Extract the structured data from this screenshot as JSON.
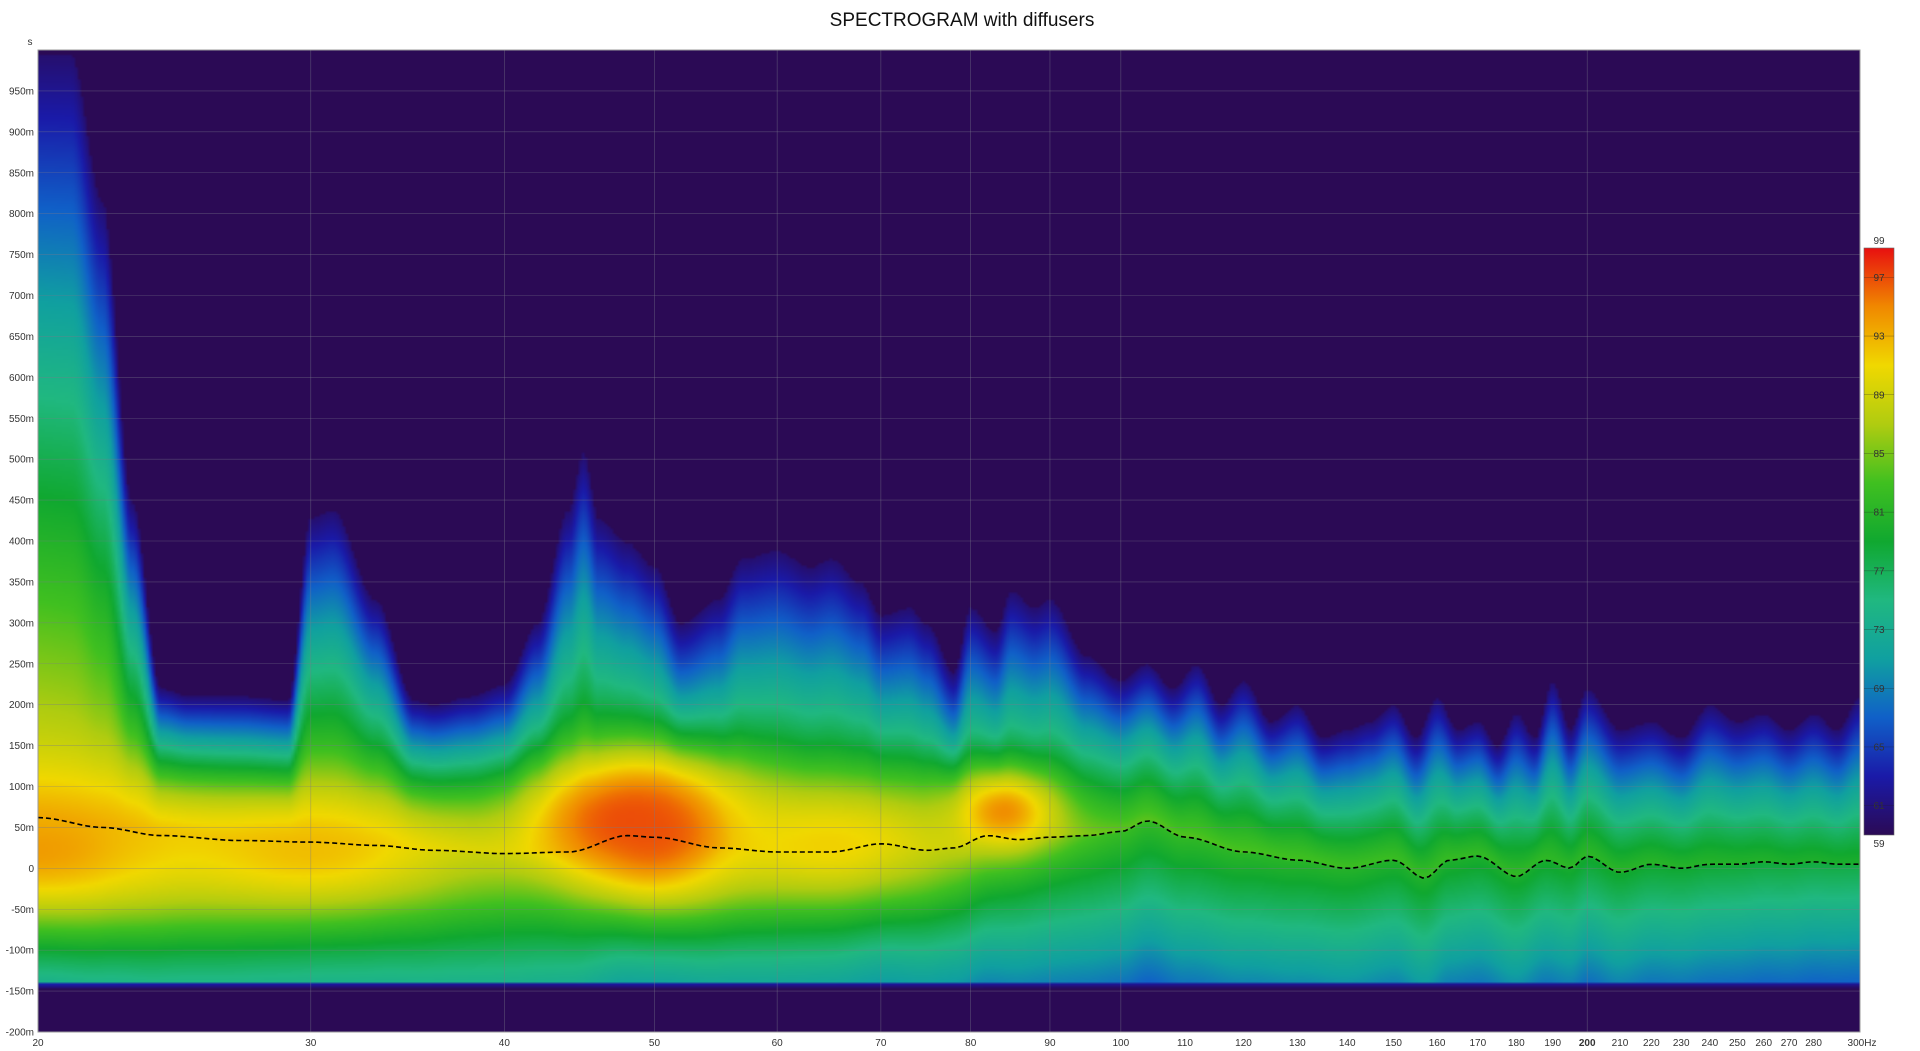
{
  "chart_data": {
    "type": "heatmap",
    "title": "SPECTROGRAM with diffusers",
    "x_axis": {
      "scale": "log",
      "unit": "Hz",
      "range": [
        20,
        300
      ],
      "major_ticks": [
        20,
        30,
        40,
        50,
        60,
        70,
        80,
        90,
        100,
        200
      ],
      "minor_ticks": [
        110,
        120,
        130,
        140,
        150,
        160,
        170,
        180,
        190,
        210,
        220,
        230,
        240,
        250,
        260,
        270,
        280
      ],
      "end_label": "300Hz"
    },
    "y_axis": {
      "unit_label": "s",
      "range_ms": [
        -200,
        1000
      ],
      "tick_values_ms": [
        950,
        900,
        850,
        800,
        750,
        700,
        650,
        600,
        550,
        500,
        450,
        400,
        350,
        300,
        250,
        200,
        150,
        100,
        50,
        0,
        -50,
        -100,
        -150,
        -200
      ],
      "tick_labels": [
        "950m",
        "900m",
        "850m",
        "800m",
        "750m",
        "700m",
        "650m",
        "600m",
        "550m",
        "500m",
        "450m",
        "400m",
        "350m",
        "300m",
        "250m",
        "200m",
        "150m",
        "100m",
        "50m",
        "0",
        "-50m",
        "-100m",
        "-150m",
        "-200m"
      ]
    },
    "color_scale": {
      "min": 59,
      "max": 99,
      "labels": [
        "99",
        "97",
        "93",
        "89",
        "85",
        "81",
        "77",
        "73",
        "69",
        "65",
        "61",
        "59"
      ],
      "label_values": [
        99,
        97,
        93,
        89,
        85,
        81,
        77,
        73,
        69,
        65,
        61,
        59
      ],
      "stops": [
        {
          "value": 59,
          "color": "#2b0a55"
        },
        {
          "value": 63,
          "color": "#1a1aa8"
        },
        {
          "value": 67,
          "color": "#1060c8"
        },
        {
          "value": 71,
          "color": "#10a0a0"
        },
        {
          "value": 75,
          "color": "#20b880"
        },
        {
          "value": 79,
          "color": "#10a830"
        },
        {
          "value": 83,
          "color": "#40c020"
        },
        {
          "value": 87,
          "color": "#b0cc10"
        },
        {
          "value": 91,
          "color": "#f0d800"
        },
        {
          "value": 95,
          "color": "#f08800"
        },
        {
          "value": 99,
          "color": "#e81010"
        }
      ]
    },
    "background_color": "#2b0a55",
    "grid": true,
    "decay_envelope": {
      "description": "Top edge of visible energy (time at which level falls to floor) per frequency",
      "freq_hz": [
        20,
        21,
        22,
        23,
        24,
        25,
        27,
        29,
        30,
        31,
        33,
        35,
        36,
        38,
        40,
        42,
        44,
        45,
        46,
        48,
        50,
        52,
        55,
        57,
        60,
        63,
        65,
        68,
        70,
        73,
        75,
        78,
        80,
        83,
        85,
        88,
        90,
        95,
        100,
        104,
        108,
        112,
        116,
        120,
        125,
        130,
        135,
        140,
        145,
        150,
        155,
        160,
        165,
        170,
        175,
        180,
        185,
        190,
        195,
        200,
        210,
        220,
        230,
        240,
        250,
        260,
        270,
        280,
        290,
        300
      ],
      "top_ms": [
        1000,
        1000,
        820,
        450,
        220,
        210,
        210,
        205,
        430,
        440,
        330,
        205,
        200,
        210,
        225,
        300,
        440,
        510,
        430,
        400,
        370,
        300,
        330,
        380,
        390,
        370,
        380,
        350,
        310,
        320,
        300,
        240,
        320,
        290,
        340,
        320,
        330,
        260,
        230,
        250,
        220,
        250,
        200,
        230,
        180,
        200,
        160,
        170,
        180,
        200,
        160,
        210,
        170,
        180,
        150,
        190,
        160,
        230,
        170,
        220,
        170,
        180,
        160,
        200,
        180,
        190,
        170,
        190,
        170,
        210
      ]
    },
    "peak_time_line": {
      "style": "dashed",
      "color": "#000000",
      "freq_hz": [
        20,
        22,
        24,
        27,
        30,
        33,
        36,
        40,
        44,
        48,
        50,
        55,
        60,
        65,
        70,
        75,
        78,
        82,
        86,
        90,
        95,
        100,
        104,
        110,
        120,
        130,
        140,
        150,
        157,
        163,
        170,
        180,
        188,
        195,
        200,
        210,
        220,
        230,
        240,
        250,
        260,
        270,
        280,
        290,
        300
      ],
      "time_ms": [
        62,
        50,
        40,
        34,
        32,
        28,
        22,
        18,
        20,
        40,
        38,
        25,
        20,
        20,
        30,
        22,
        25,
        40,
        35,
        38,
        40,
        45,
        58,
        38,
        20,
        10,
        0,
        10,
        -12,
        10,
        15,
        -10,
        10,
        0,
        15,
        -5,
        5,
        0,
        5,
        5,
        8,
        5,
        8,
        5,
        5
      ]
    },
    "energy_hotspots": [
      {
        "freq_hz": 20,
        "time_ms": 20,
        "level_db": 95,
        "width_octave": 0.35,
        "height_ms": 90
      },
      {
        "freq_hz": 48,
        "time_ms": 60,
        "level_db": 98,
        "width_octave": 0.22,
        "height_ms": 70
      },
      {
        "freq_hz": 50,
        "time_ms": 40,
        "level_db": 97,
        "width_octave": 0.18,
        "height_ms": 90
      },
      {
        "freq_hz": 84,
        "time_ms": 70,
        "level_db": 96,
        "width_octave": 0.12,
        "height_ms": 50
      },
      {
        "freq_hz": 30,
        "time_ms": 20,
        "level_db": 93,
        "width_octave": 0.35,
        "height_ms": 80
      },
      {
        "freq_hz": 65,
        "time_ms": 30,
        "level_db": 92,
        "width_octave": 0.3,
        "height_ms": 80
      }
    ]
  }
}
